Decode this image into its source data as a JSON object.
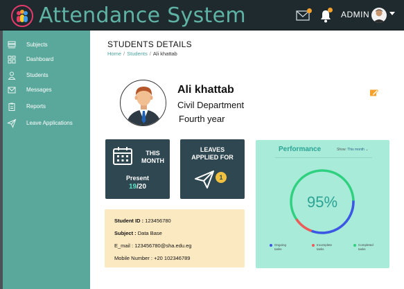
{
  "header": {
    "app_title": "Attendance System",
    "admin_label": "ADMIN"
  },
  "sidebar": {
    "items": [
      {
        "label": "Subjects",
        "icon": "subjects-icon"
      },
      {
        "label": "Dashboard",
        "icon": "dashboard-icon"
      },
      {
        "label": "Students",
        "icon": "user-icon"
      },
      {
        "label": "Messages",
        "icon": "mail-icon"
      },
      {
        "label": "Reports",
        "icon": "clipboard-icon"
      },
      {
        "label": "Leave Applications",
        "icon": "send-icon"
      }
    ]
  },
  "page": {
    "title": "STUDENTS DETAILS",
    "breadcrumb": [
      "Home",
      "Students",
      "Ali khattab"
    ]
  },
  "student": {
    "name": "Ali khattab",
    "department": "Civil Department",
    "year": "Fourth year"
  },
  "month_card": {
    "title_line1": "THIS",
    "title_line2": "MONTH",
    "present_label": "Present",
    "present_count": "19",
    "present_total": "/20"
  },
  "leaves_card": {
    "title_line1": "LEAVES",
    "title_line2": "APPLIED FOR",
    "count": "1"
  },
  "info": {
    "student_id_label": "Student ID :",
    "student_id": "123456780",
    "subject_label": "Subject :",
    "subject": "Data Base",
    "email_label": "E_mail :",
    "email": "123456780@sha.edu.eg",
    "mobile_label": "Mobile Number :",
    "mobile": "+20 102346789"
  },
  "performance": {
    "title": "Performance",
    "show_label": "Show:",
    "period": "This month",
    "percent_label": "95%",
    "percent": 95,
    "legend": [
      {
        "label": "Ongoing tasks",
        "line1": "Ongoing",
        "line2": "tasks",
        "color": "#3d56e8"
      },
      {
        "label": "Incomplete tasks",
        "line1": "Incomplete",
        "line2": "tasks",
        "color": "#ef5a5a"
      },
      {
        "label": "Completed tasks",
        "line1": "Completed",
        "line2": "tasks",
        "color": "#2fd07f"
      }
    ]
  },
  "colors": {
    "header_bg": "#1f2a2f",
    "sidebar_bg": "#5aa89b",
    "card_dark": "#2e4750",
    "info_bg": "#fbe9c2",
    "perf_bg": "#a9ebd9",
    "accent_orange": "#f4a22b"
  }
}
